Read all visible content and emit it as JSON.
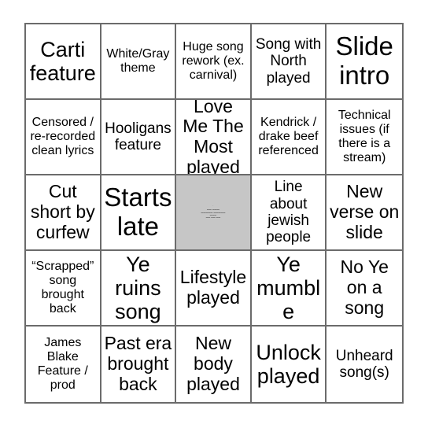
{
  "card": {
    "type": "bingo-card",
    "columns": 5,
    "rows": 5,
    "background_color": "#ffffff",
    "border_color": "#6b6b6b",
    "text_color": "#000000",
    "free_space_color": "#c6c6c6",
    "free_space_text_color": "#6f6f6f",
    "cells": [
      {
        "text": "Carti feature",
        "size": "fs-xl",
        "free": false
      },
      {
        "text": "White/Gray theme",
        "size": "fs-sm",
        "free": false
      },
      {
        "text": "Huge song rework (ex. carnival)",
        "size": "fs-sm",
        "free": false
      },
      {
        "text": "Song with North played",
        "size": "fs-md",
        "free": false
      },
      {
        "text": "Slide intro",
        "size": "fs-xxl",
        "free": false
      },
      {
        "text": "Censored / re-recorded clean lyrics",
        "size": "fs-sm",
        "free": false
      },
      {
        "text": "Hooligans feature",
        "size": "fs-md",
        "free": false
      },
      {
        "text": "Love Me The Most played",
        "size": "fs-lg",
        "free": false
      },
      {
        "text": "Kendrick / drake beef referenced",
        "size": "fs-sm",
        "free": false
      },
      {
        "text": "Technical issues (if there is a stream)",
        "size": "fs-sm",
        "free": false
      },
      {
        "text": "Cut short by curfew",
        "size": "fs-lg",
        "free": false
      },
      {
        "text": "Starts late",
        "size": "fs-xxl",
        "free": false
      },
      {
        "text": "",
        "size": "fs-sm",
        "free": true
      },
      {
        "text": "Line about jewish people",
        "size": "fs-md",
        "free": false
      },
      {
        "text": "New verse on slide",
        "size": "fs-lg",
        "free": false
      },
      {
        "text": "“Scrapped” song brought back",
        "size": "fs-sm",
        "free": false
      },
      {
        "text": "Ye ruins song",
        "size": "fs-xl",
        "free": false
      },
      {
        "text": "Lifestyle played",
        "size": "fs-lg",
        "free": false
      },
      {
        "text": "Ye mumble",
        "size": "fs-xl",
        "free": false
      },
      {
        "text": "No Ye on a song",
        "size": "fs-lg",
        "free": false
      },
      {
        "text": "James Blake Feature / prod",
        "size": "fs-sm",
        "free": false
      },
      {
        "text": "Past era brought back",
        "size": "fs-lg",
        "free": false
      },
      {
        "text": "New body played",
        "size": "fs-lg",
        "free": false
      },
      {
        "text": "Unlock played",
        "size": "fs-xl",
        "free": false
      },
      {
        "text": "Unheard song(s)",
        "size": "fs-md",
        "free": false
      }
    ]
  },
  "free_space": {
    "label": "free-space",
    "note": "tiny illegible watermark text, 5 lines",
    "lines": [
      "•",
      "▬▬ ▬▬▬",
      "▬▬▬▬▬ ▬▬▬▬▬",
      "▬▬▬",
      "▬▬ ▬▬ ▬▬"
    ]
  }
}
